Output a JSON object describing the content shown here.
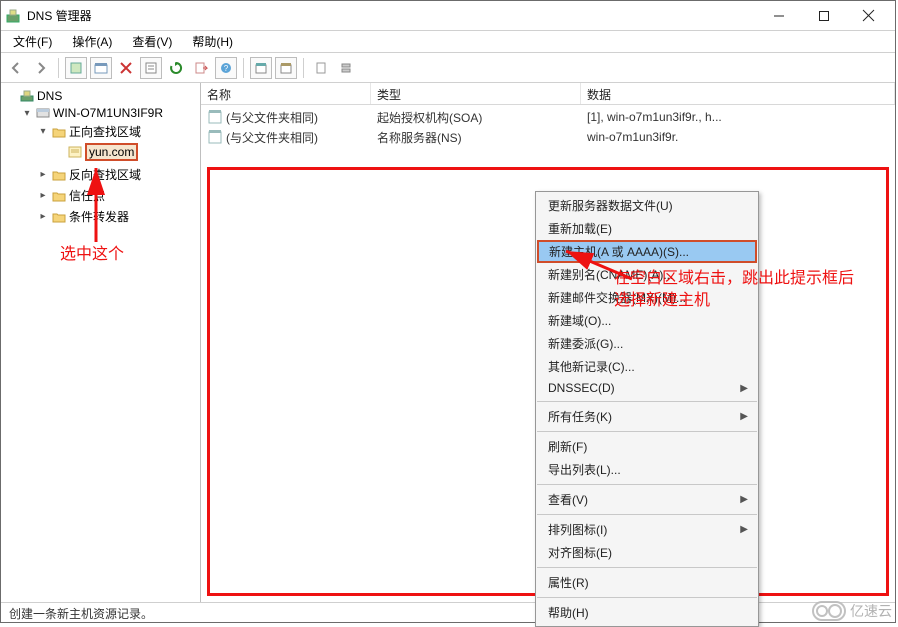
{
  "title": "DNS 管理器",
  "menubar": [
    "文件(F)",
    "操作(A)",
    "查看(V)",
    "帮助(H)"
  ],
  "tree": {
    "root": "DNS",
    "server": "WIN-O7M1UN3IF9R",
    "nodes": [
      {
        "label": "正向查找区域",
        "expanded": true,
        "children": [
          {
            "label": "yun.com",
            "selected": true
          }
        ]
      },
      {
        "label": "反向查找区域",
        "expanded": false
      },
      {
        "label": "信任点",
        "expanded": false
      },
      {
        "label": "条件转发器",
        "expanded": false
      }
    ]
  },
  "columns": {
    "name": "名称",
    "type": "类型",
    "data": "数据"
  },
  "rows": [
    {
      "name": "(与父文件夹相同)",
      "type": "起始授权机构(SOA)",
      "data": "[1], win-o7m1un3if9r., h..."
    },
    {
      "name": "(与父文件夹相同)",
      "type": "名称服务器(NS)",
      "data": "win-o7m1un3if9r."
    }
  ],
  "context_menu": [
    {
      "label": "更新服务器数据文件(U)",
      "type": "item"
    },
    {
      "label": "重新加载(E)",
      "type": "item"
    },
    {
      "label": "新建主机(A 或 AAAA)(S)...",
      "type": "item",
      "highlight": true
    },
    {
      "label": "新建别名(CNAME)(A)...",
      "type": "item"
    },
    {
      "label": "新建邮件交换器(MX)(M)...",
      "type": "item"
    },
    {
      "label": "新建域(O)...",
      "type": "item"
    },
    {
      "label": "新建委派(G)...",
      "type": "item"
    },
    {
      "label": "其他新记录(C)...",
      "type": "item"
    },
    {
      "label": "DNSSEC(D)",
      "type": "item",
      "submenu": true
    },
    {
      "type": "sep"
    },
    {
      "label": "所有任务(K)",
      "type": "item",
      "submenu": true
    },
    {
      "type": "sep"
    },
    {
      "label": "刷新(F)",
      "type": "item"
    },
    {
      "label": "导出列表(L)...",
      "type": "item"
    },
    {
      "type": "sep"
    },
    {
      "label": "查看(V)",
      "type": "item",
      "submenu": true
    },
    {
      "type": "sep"
    },
    {
      "label": "排列图标(I)",
      "type": "item",
      "submenu": true
    },
    {
      "label": "对齐图标(E)",
      "type": "item"
    },
    {
      "type": "sep"
    },
    {
      "label": "属性(R)",
      "type": "item"
    },
    {
      "type": "sep"
    },
    {
      "label": "帮助(H)",
      "type": "item"
    }
  ],
  "annotations": {
    "left_label": "选中这个",
    "right_label": "在空白区域右击，跳出此提示框后选择新建主机"
  },
  "statusbar": "创建一条新主机资源记录。",
  "watermark": "亿速云"
}
